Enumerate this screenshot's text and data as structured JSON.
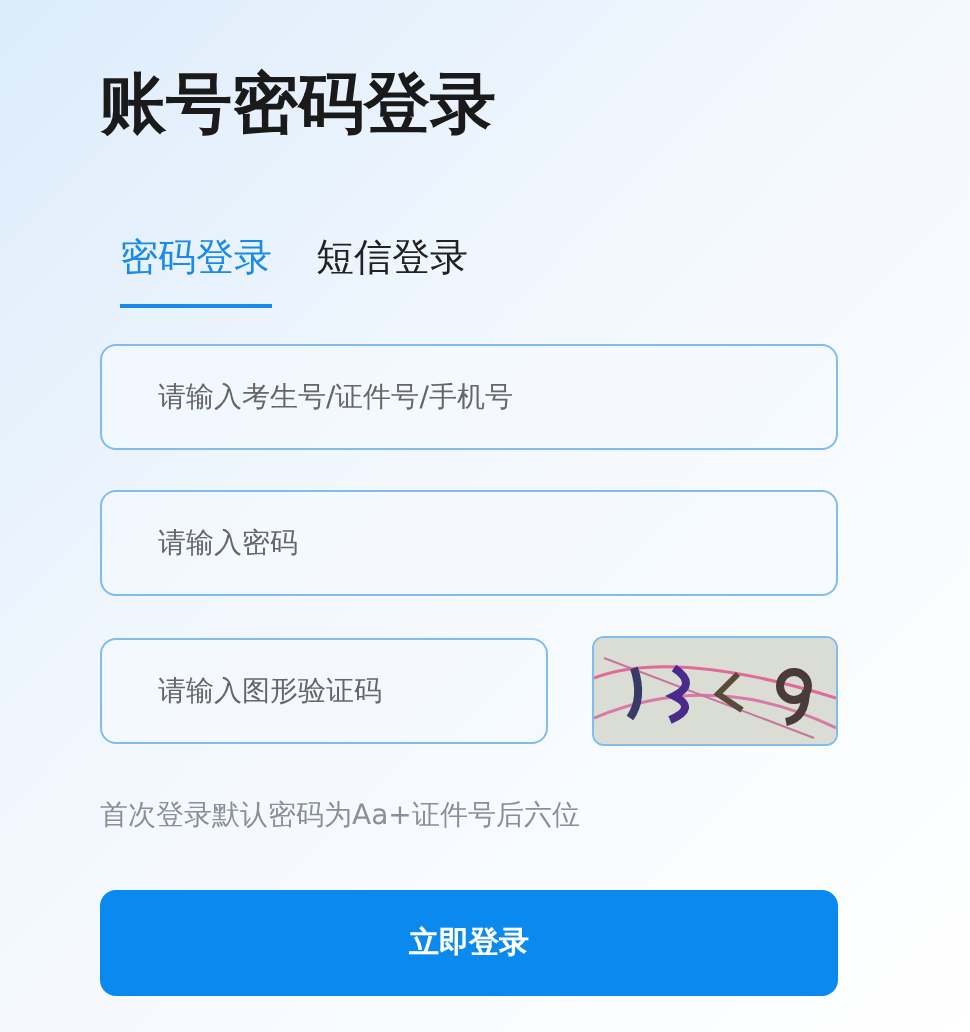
{
  "title": "账号密码登录",
  "tabs": [
    {
      "label": "密码登录",
      "selected": true
    },
    {
      "label": "短信登录",
      "selected": false
    }
  ],
  "fields": [
    {
      "kind": "text",
      "placeholder": "请输入考生号/证件号/手机号"
    },
    {
      "kind": "password",
      "placeholder": "请输入密码"
    },
    {
      "kind": "captcha",
      "placeholder": "请输入图形验证码"
    }
  ],
  "hint": "首次登录默认密码为Aa+证件号后六位",
  "submit_button": "立即登录"
}
